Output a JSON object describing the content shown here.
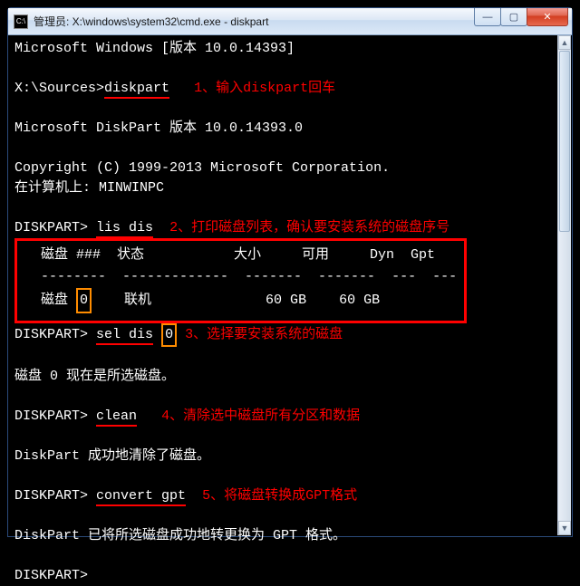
{
  "window": {
    "title": "管理员: X:\\windows\\system32\\cmd.exe - diskpart",
    "sysicon": "C:\\",
    "btn_min": "—",
    "btn_max": "▢",
    "btn_close": "✕"
  },
  "scroll": {
    "up": "▲",
    "down": "▼"
  },
  "lines": {
    "l1": "Microsoft Windows [版本 10.0.14393]",
    "l2_prompt": "X:\\Sources>",
    "l2_cmd": "diskpart",
    "ann1": "1、输入diskpart回车",
    "l3": "Microsoft DiskPart 版本 10.0.14393.0",
    "l4": "Copyright (C) 1999-2013 Microsoft Corporation.",
    "l5": "在计算机上: MINWINPC",
    "p_diskpart": "DISKPART>",
    "cmd_lisdis": "lis dis",
    "ann2": "2、打印磁盘列表，确认要安装系统的磁盘序号",
    "table_header": "  磁盘 ###  状态           大小     可用     Dyn  Gpt",
    "table_dash": "  --------  -------------  -------  -------  ---  ---",
    "row_pre": "  磁盘 ",
    "row_disknum": "0",
    "row_post": "    联机              60 GB    60 GB",
    "cmd_seldis": "sel dis",
    "seldis_num": "0",
    "ann3": "3、选择要安装系统的磁盘",
    "l_sel": "磁盘 0 现在是所选磁盘。",
    "cmd_clean": "clean",
    "ann4": "4、清除选中磁盘所有分区和数据",
    "l_clean": "DiskPart 成功地清除了磁盘。",
    "cmd_conv": "convert gpt",
    "ann5": "5、将磁盘转换成GPT格式",
    "l_conv": "DiskPart 已将所选磁盘成功地转更换为 GPT 格式。"
  }
}
